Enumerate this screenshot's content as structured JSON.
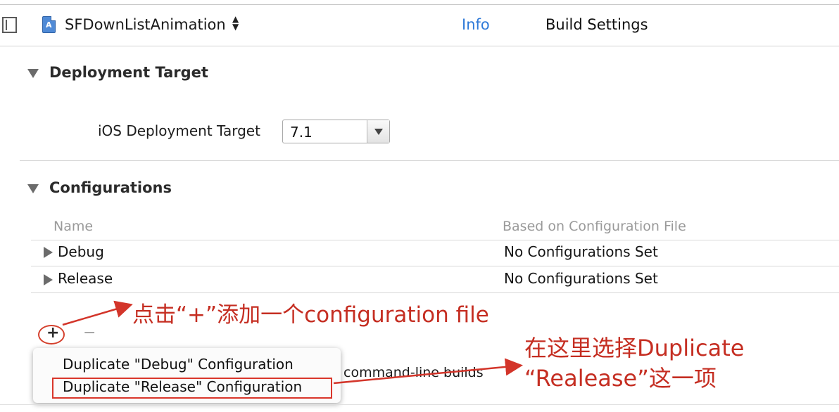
{
  "toolbar": {
    "project_name": "SFDownListAnimation",
    "stepper_glyph": "▴▾",
    "tabs": [
      {
        "label": "Info",
        "active": true
      },
      {
        "label": "Build Settings",
        "active": false
      }
    ]
  },
  "deployment": {
    "title": "Deployment Target",
    "ios_label": "iOS Deployment Target",
    "ios_value": "7.1"
  },
  "configurations": {
    "title": "Configurations",
    "columns": [
      "Name",
      "Based on Configuration File"
    ],
    "rows": [
      {
        "name": "Debug",
        "file": "No Configurations Set"
      },
      {
        "name": "Release",
        "file": "No Configurations Set"
      }
    ],
    "add_glyph": "+",
    "remove_glyph": "−",
    "behind_text": "command-line builds"
  },
  "popup_menu": {
    "items": [
      {
        "label": "Duplicate \"Debug\" Configuration"
      },
      {
        "label": "Duplicate \"Release\" Configuration"
      }
    ]
  },
  "annotations": {
    "click_plus": "点击“+”添加一个configuration file",
    "choose_line1": "在这里选择Duplicate",
    "choose_line2": "“Realease”这一项"
  },
  "colors": {
    "accent_tab": "#2f7ad8",
    "annotation_red": "#c52e22"
  }
}
